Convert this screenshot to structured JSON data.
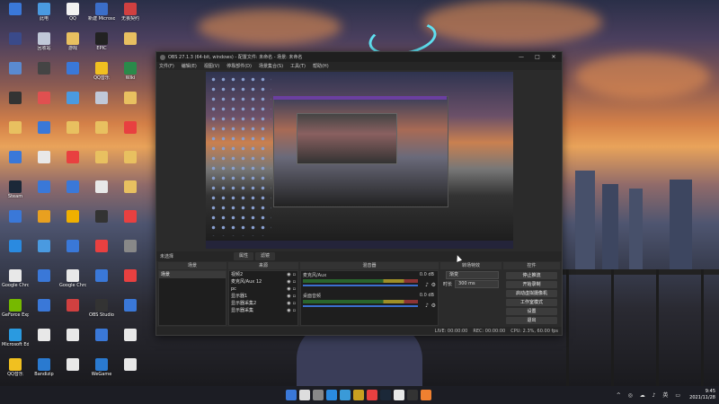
{
  "desktop": {
    "icons": [
      {
        "label": "",
        "color": "#3a78d8"
      },
      {
        "label": "此电",
        "color": "#4a9ae0"
      },
      {
        "label": "QQ",
        "color": "#f2f2f2"
      },
      {
        "label": "新建 Microsoft...",
        "color": "#3b6ec9"
      },
      {
        "label": "无畏契约",
        "color": "#d04040"
      },
      {
        "label": "",
        "color": "#3a4a8a"
      },
      {
        "label": "回收站",
        "color": "#c0c8d8"
      },
      {
        "label": "游戏",
        "color": "#e8c060"
      },
      {
        "label": "EPIC",
        "color": "#222222"
      },
      {
        "label": "",
        "color": "#e8c060"
      },
      {
        "label": "",
        "color": "#5a8ad0"
      },
      {
        "label": "",
        "color": "#444444"
      },
      {
        "label": "",
        "color": "#3a78d8"
      },
      {
        "label": "QQ音乐",
        "color": "#f0c020"
      },
      {
        "label": "Wiki",
        "color": "#2a8a4a"
      },
      {
        "label": "",
        "color": "#333333"
      },
      {
        "label": "",
        "color": "#e05050"
      },
      {
        "label": "",
        "color": "#4a9ae0"
      },
      {
        "label": "",
        "color": "#c0c8d8"
      },
      {
        "label": "",
        "color": "#e8c060"
      },
      {
        "label": "",
        "color": "#e8c060"
      },
      {
        "label": "",
        "color": "#3a78d8"
      },
      {
        "label": "",
        "color": "#e8c060"
      },
      {
        "label": "",
        "color": "#e8c060"
      },
      {
        "label": "",
        "color": "#e84040"
      },
      {
        "label": "",
        "color": "#3a78d8"
      },
      {
        "label": "",
        "color": "#e8e8e8"
      },
      {
        "label": "",
        "color": "#e84040"
      },
      {
        "label": "",
        "color": "#e8c060"
      },
      {
        "label": "",
        "color": "#e8c060"
      },
      {
        "label": "Steam",
        "color": "#1b2838"
      },
      {
        "label": "",
        "color": "#3a78d8"
      },
      {
        "label": "",
        "color": "#3a78d8"
      },
      {
        "label": "",
        "color": "#e8e8e8"
      },
      {
        "label": "",
        "color": "#e8c060"
      },
      {
        "label": "",
        "color": "#3a78d8"
      },
      {
        "label": "",
        "color": "#e8a020"
      },
      {
        "label": "",
        "color": "#f0b000"
      },
      {
        "label": "",
        "color": "#333333"
      },
      {
        "label": "",
        "color": "#e84040"
      },
      {
        "label": "",
        "color": "#2a8ae0"
      },
      {
        "label": "",
        "color": "#4a9ae0"
      },
      {
        "label": "",
        "color": "#3a78d8"
      },
      {
        "label": "",
        "color": "#e84040"
      },
      {
        "label": "",
        "color": "#888888"
      },
      {
        "label": "Google Chrome",
        "color": "#e8e8e8"
      },
      {
        "label": "",
        "color": "#3a78d8"
      },
      {
        "label": "Google Chrome",
        "color": "#e8e8e8"
      },
      {
        "label": "",
        "color": "#3a78d8"
      },
      {
        "label": "",
        "color": "#e84040"
      },
      {
        "label": "GeForce Experience",
        "color": "#76b900"
      },
      {
        "label": "",
        "color": "#3a78d8"
      },
      {
        "label": "",
        "color": "#d04040"
      },
      {
        "label": "OBS Studio",
        "color": "#333333"
      },
      {
        "label": "",
        "color": "#3a78d8"
      },
      {
        "label": "Microsoft Edge",
        "color": "#2a9ae0"
      },
      {
        "label": "",
        "color": "#e8e8e8"
      },
      {
        "label": "",
        "color": "#e8e8e8"
      },
      {
        "label": "",
        "color": "#3a78d8"
      },
      {
        "label": "",
        "color": "#e8e8e8"
      },
      {
        "label": "QQ音乐",
        "color": "#f0c020"
      },
      {
        "label": "Bandizip",
        "color": "#2a7ad0"
      },
      {
        "label": "",
        "color": "#e8e8e8"
      },
      {
        "label": "WeGame",
        "color": "#2a7ad0"
      },
      {
        "label": "",
        "color": "#e8e8e8"
      }
    ]
  },
  "obs": {
    "title": "OBS 27.1.3 (64-bit, windows) - 配置文件: 未命名 - 场景: 未命名",
    "menu": [
      "文件(F)",
      "编辑(E)",
      "视图(V)",
      "停靠部件(D)",
      "场景集合(S)",
      "工具(T)",
      "帮助(H)"
    ],
    "window_buttons": [
      "—",
      "□",
      "✕"
    ],
    "scene_bar": {
      "selected": "未选择",
      "tab1": "属性",
      "tab2": "滤镜"
    },
    "docks": {
      "scenes": {
        "title": "场景",
        "items": [
          "场景"
        ],
        "footer": [
          "+",
          "—",
          "∧",
          "∨"
        ]
      },
      "sources": {
        "title": "来源",
        "items": [
          "视频2",
          "麦克风/Aux 12",
          "pc",
          "显示器1",
          "显示器采集2",
          "显示器采集"
        ],
        "footer": [
          "+",
          "—",
          "⚙",
          "∧",
          "∨"
        ]
      },
      "mixer": {
        "title": "混音器",
        "channels": [
          {
            "name": "麦克风/Aux",
            "db": "0.0 dB"
          },
          {
            "name": "桌面音频",
            "db": "0.0 dB"
          }
        ]
      },
      "transitions": {
        "title": "转场特效",
        "type": "渐变",
        "duration_label": "时长",
        "duration": "300 ms"
      },
      "controls": {
        "title": "控件",
        "buttons": [
          "停止推流",
          "开始录制",
          "启动虚拟摄像机",
          "工作室模式",
          "设置",
          "退出"
        ]
      }
    },
    "status": {
      "live": "LIVE: 00:00:00",
      "rec": "REC: 00:00:00",
      "cpu": "CPU: 2.3%, 60.00 fps"
    }
  },
  "taskbar": {
    "icons": [
      "#3a78d8",
      "#dddddd",
      "#888888",
      "#2a8ae0",
      "#3a9ad8",
      "#c8a020",
      "#e84040",
      "#1b2838",
      "#e8e8e8",
      "#333333",
      "#f08030"
    ],
    "tray": "^ ◎ ☁ ♪ 英 ▭",
    "time": "9:45",
    "date": "2021/11/28"
  }
}
